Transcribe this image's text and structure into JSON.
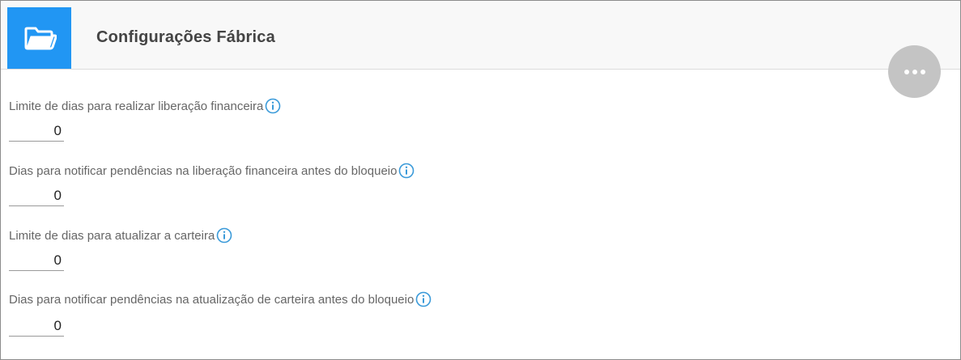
{
  "header": {
    "icon": "folder-open-icon",
    "title": "Configurações Fábrica",
    "accent_color": "#2196f3"
  },
  "more_button": {
    "icon": "more-horizontal-icon"
  },
  "fields": [
    {
      "label": "Limite de dias para realizar liberação financeira",
      "value": "0"
    },
    {
      "label": "Dias para notificar pendências na liberação financeira antes do bloqueio",
      "value": "0"
    },
    {
      "label": "Limite de dias para atualizar a carteira",
      "value": "0"
    },
    {
      "label": "Dias para notificar pendências na atualização de carteira antes do bloqueio",
      "value": "0"
    }
  ],
  "info_icon": "info-circle-icon",
  "info_icon_color": "#3a9ad9"
}
